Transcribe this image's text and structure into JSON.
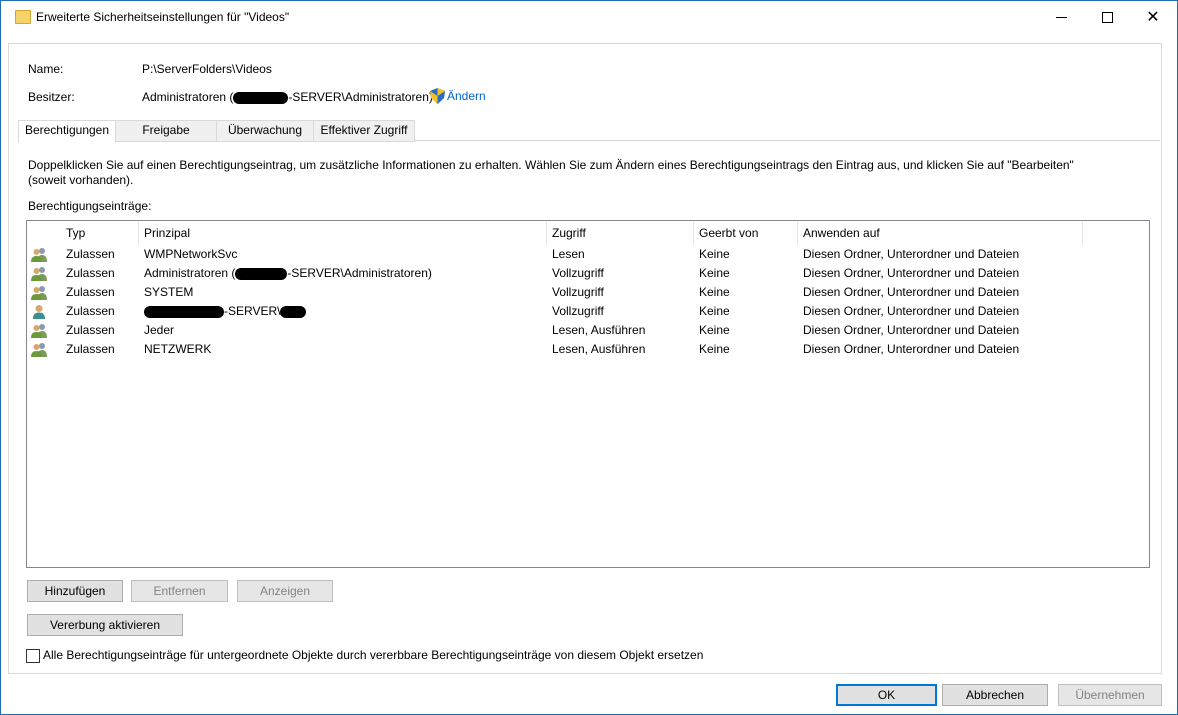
{
  "window": {
    "title": "Erweiterte Sicherheitseinstellungen für \"Videos\""
  },
  "info": {
    "name_label": "Name:",
    "name_value": "P:\\ServerFolders\\Videos",
    "owner_label": "Besitzer:",
    "owner_prefix": "Administratoren (",
    "owner_suffix": "-SERVER\\Administratoren)",
    "change_link": "Ändern"
  },
  "tabs": [
    {
      "label": "Berechtigungen",
      "active": true
    },
    {
      "label": "Freigabe"
    },
    {
      "label": "Überwachung"
    },
    {
      "label": "Effektiver Zugriff"
    }
  ],
  "description": "Doppelklicken Sie auf einen Berechtigungseintrag, um zusätzliche Informationen zu erhalten. Wählen Sie zum Ändern eines Berechtigungseintrags den Eintrag aus, und klicken Sie auf \"Bearbeiten\" (soweit vorhanden).",
  "entries_label": "Berechtigungseinträge:",
  "columns": [
    "Typ",
    "Prinzipal",
    "Zugriff",
    "Geerbt von",
    "Anwenden auf"
  ],
  "rows": [
    {
      "icon": "group-icon",
      "typ": "Zulassen",
      "prinzipal": "WMPNetworkSvc",
      "zugriff": "Lesen",
      "geerbt": "Keine",
      "anwenden": "Diesen Ordner, Unterordner und Dateien"
    },
    {
      "icon": "group-icon",
      "typ": "Zulassen",
      "prinzipal_prefix": "Administratoren (",
      "prinzipal_suffix": "-SERVER\\Administratoren)",
      "zugriff": "Vollzugriff",
      "geerbt": "Keine",
      "anwenden": "Diesen Ordner, Unterordner und Dateien"
    },
    {
      "icon": "group-icon",
      "typ": "Zulassen",
      "prinzipal": "SYSTEM",
      "zugriff": "Vollzugriff",
      "geerbt": "Keine",
      "anwenden": "Diesen Ordner, Unterordner und Dateien"
    },
    {
      "icon": "user-icon",
      "typ": "Zulassen",
      "prinzipal_suffix": "-SERVER\\",
      "zugriff": "Vollzugriff",
      "geerbt": "Keine",
      "anwenden": "Diesen Ordner, Unterordner und Dateien"
    },
    {
      "icon": "group-icon",
      "typ": "Zulassen",
      "prinzipal": "Jeder",
      "zugriff": "Lesen, Ausführen",
      "geerbt": "Keine",
      "anwenden": "Diesen Ordner, Unterordner und Dateien"
    },
    {
      "icon": "group-icon",
      "typ": "Zulassen",
      "prinzipal": "NETZWERK",
      "zugriff": "Lesen, Ausführen",
      "geerbt": "Keine",
      "anwenden": "Diesen Ordner, Unterordner und Dateien"
    }
  ],
  "buttons": {
    "add": "Hinzufügen",
    "remove": "Entfernen",
    "view": "Anzeigen",
    "inheritance": "Vererbung aktivieren",
    "ok": "OK",
    "cancel": "Abbrechen",
    "apply": "Übernehmen"
  },
  "replace_checkbox": {
    "label": "Alle Berechtigungseinträge für untergeordnete Objekte durch vererbbare Berechtigungseinträge von diesem Objekt ersetzen",
    "checked": false
  },
  "colors": {
    "link": "#0066cc",
    "accent": "#0078d7"
  }
}
